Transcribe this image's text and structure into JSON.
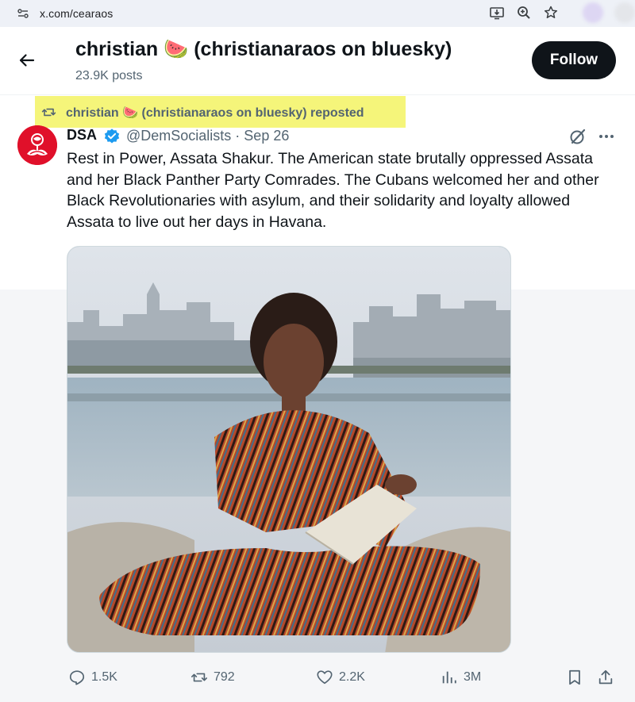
{
  "browser": {
    "url": "x.com/cearaos"
  },
  "profile": {
    "name": "christian 🍉 (christianaraos on bluesky)",
    "posts": "23.9K posts",
    "follow_label": "Follow"
  },
  "repost": {
    "text": "christian 🍉 (christianaraos on bluesky) reposted"
  },
  "tweet": {
    "author": "DSA",
    "handle_date": "@DemSocialists · Sep 26",
    "text": "Rest in Power, Assata Shakur. The American state brutally oppressed Assata and her Black Panther Party Comrades. The Cubans welcomed her and other Black Revolutionaries with asylum, and their solidarity and loyalty allowed Assata to live out her days in Havana."
  },
  "actions": {
    "replies": "1.5K",
    "reposts": "792",
    "likes": "2.2K",
    "views": "3M"
  },
  "colors": {
    "accent_blue": "#1d9bf0",
    "highlight": "#f5f57a",
    "avatar_red": "#e0102a"
  }
}
